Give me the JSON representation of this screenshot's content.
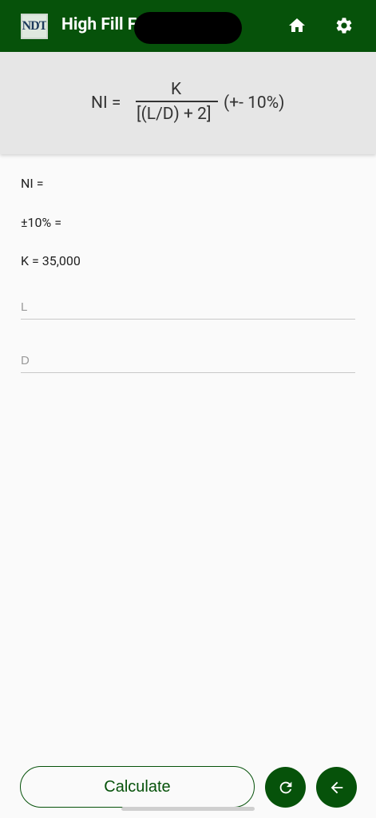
{
  "appbar": {
    "title": "High Fill F",
    "logo_text": "NDT",
    "icons": {
      "home": "home-icon",
      "settings": "gear-icon"
    },
    "color": "#06520a"
  },
  "formula": {
    "lhs": "NI =",
    "numerator": "K",
    "denominator": "[(L/D) + 2]",
    "tolerance": "(+- 10%)"
  },
  "results": {
    "ni_label": "NI =",
    "tolerance_label": "±10% =",
    "k_label": "K = 35,000"
  },
  "inputs": {
    "l": {
      "placeholder": "L",
      "value": ""
    },
    "d": {
      "placeholder": "D",
      "value": ""
    }
  },
  "actions": {
    "calculate_label": "Calculate",
    "refresh_icon": "refresh-icon",
    "back_icon": "arrow-back-icon"
  }
}
